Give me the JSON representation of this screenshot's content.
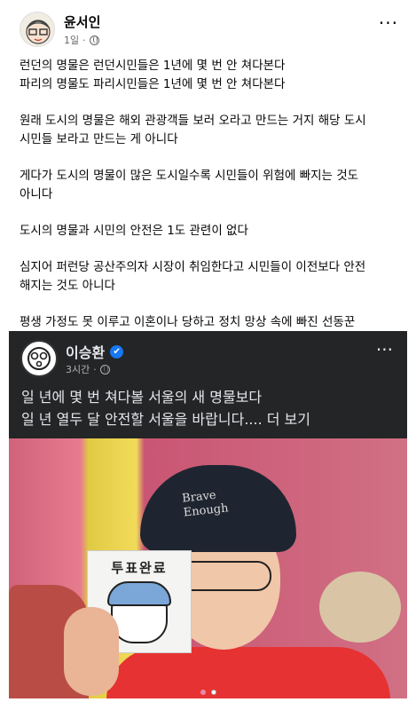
{
  "post": {
    "author": "윤서인",
    "time": "1일",
    "dot": "·",
    "more": "···",
    "paragraphs": [
      "런던의 명물은 런던시민들은 1년에 몇 번 안 쳐다본다\n파리의 명물도 파리시민들은 1년에 몇 번 안 쳐다본다",
      "원래 도시의 명물은 해외 관광객들 보러 오라고 만드는 거지 해당 도시\n시민들 보라고 만드는 게 아니다",
      "게다가 도시의 명물이 많은 도시일수록 시민들이 위험에 빠지는 것도\n아니다",
      "도시의 명물과 시민의 안전은 1도 관련이 없다",
      "심지어 퍼런당 공산주의자 시장이 취임한다고 시민들이 이전보다 안전\n해지는 것도 아니다",
      "평생 가정도 못 이루고 이혼이나 당하고 정치 망상 속에 빠진 선동꾼\n인생 나이가 환갑인데 아직도 이상한 소리나 하고 사네 서글프다"
    ]
  },
  "shared_post": {
    "author": "이승환",
    "verified_icon": "✔",
    "time": "3시간",
    "dot": "·",
    "more": "···",
    "text": "일 년에 몇 번 쳐다볼 서울의 새 명물보다\n일 년 열두 달 안전할 서울을 바랍니다.... 더 보기",
    "photo": {
      "cap_text": "Brave\nEnough",
      "card_text": "투표완료"
    }
  },
  "carousel": {
    "count": 2,
    "active_index": 1
  },
  "icons": {
    "globe": "globe-icon",
    "more": "more-options-icon",
    "verified": "verified-badge-icon"
  }
}
